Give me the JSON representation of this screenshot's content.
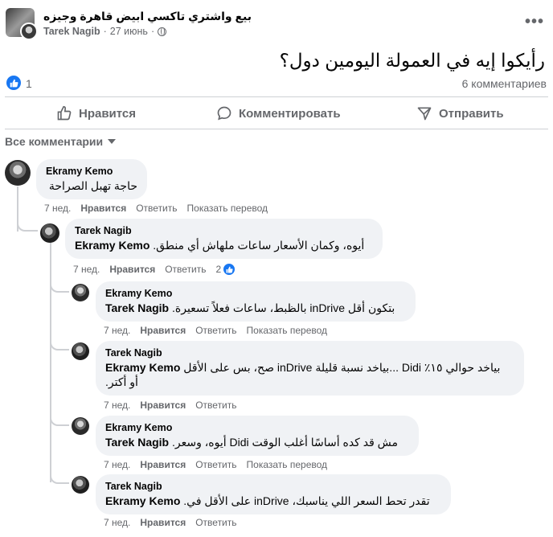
{
  "post": {
    "group_name": "بيع واشتري تاكسي ابيض قاهرة وجيزه",
    "author": "Tarek Nagib",
    "separator": "·",
    "date": "27 июнь",
    "dot": "·",
    "text": "رأيكوا إيه في العمولة اليومين دول؟",
    "like_count": "1",
    "comment_count": "6 комментариев",
    "more": "•••"
  },
  "actions": {
    "like": "Нравится",
    "comment": "Комментировать",
    "share": "Отправить"
  },
  "filter": {
    "label": "Все комментарии"
  },
  "comments": [
    {
      "name": "Ekramy Kemo",
      "mention": "",
      "text": "حاجة تهبل الصراحة",
      "time": "7 нед.",
      "like": "Нравится",
      "reply": "Ответить",
      "translate": "Показать перевод"
    },
    {
      "name": "Tarek Nagib",
      "mention": "Ekramy Kemo",
      "text": "أيوه، وكمان الأسعار ساعات ملهاش أي منطق.",
      "time": "7 нед.",
      "like": "Нравится",
      "reply": "Ответить",
      "reactions": "2"
    },
    {
      "name": "Ekramy Kemo",
      "mention": "Tarek Nagib",
      "text": "بتكون أقل inDrive بالظبط، ساعات فعلاً تسعيرة.",
      "time": "7 нед.",
      "like": "Нравится",
      "reply": "Ответить",
      "translate": "Показать перевод"
    },
    {
      "name": "Tarek Nagib",
      "mention": "Ekramy Kemo",
      "text_line1": "بياخد حوالي ١٥٪ Didi ...بياخد نسبة قليلة inDrive صح، بس على الأقل",
      "text_line2": "أو أكتر.",
      "time": "7 нед.",
      "like": "Нравится",
      "reply": "Ответить"
    },
    {
      "name": "Ekramy Kemo",
      "mention": "Tarek Nagib",
      "text": "مش قد كده أساسًا أغلب الوقت Didi أيوه، وسعر.",
      "time": "7 нед.",
      "like": "Нравится",
      "reply": "Ответить",
      "translate": "Показать перевод"
    },
    {
      "name": "Tarek Nagib",
      "mention": "Ekramy Kemo",
      "text": "تقدر تحط السعر اللي يناسبك، inDrive على الأقل في.",
      "time": "7 нед.",
      "like": "Нравится",
      "reply": "Ответить"
    }
  ],
  "colors": {
    "accent": "#1877f2",
    "secondary_text": "#65676b",
    "bubble": "#f0f2f5"
  }
}
